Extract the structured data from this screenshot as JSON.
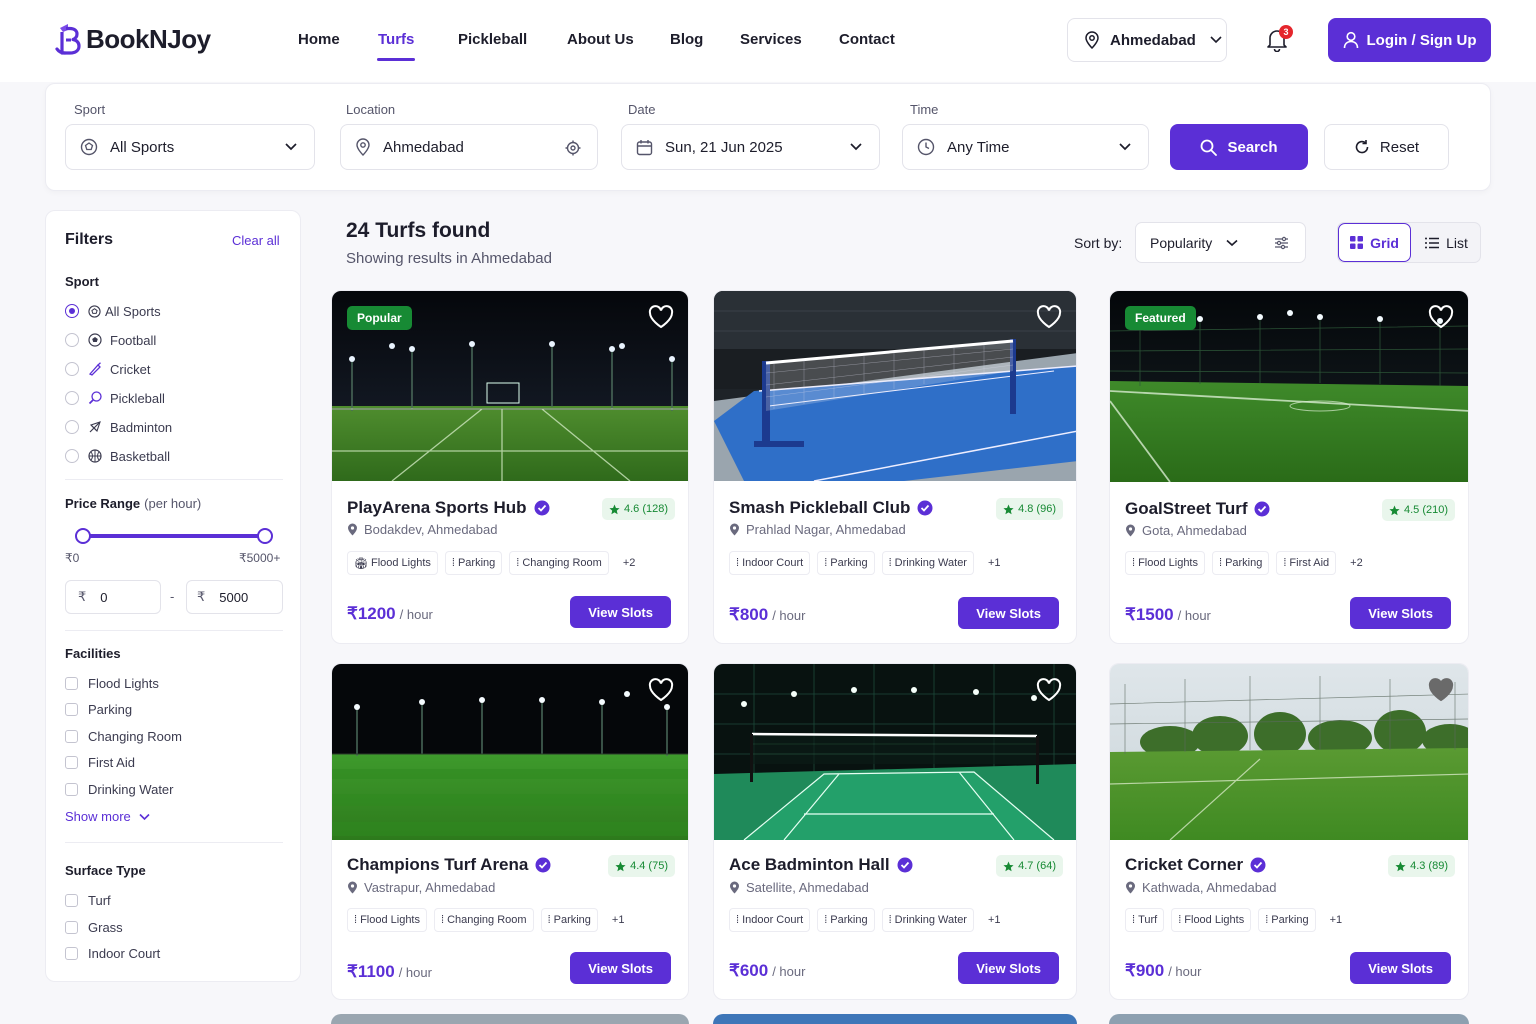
{
  "brand": {
    "name": "BookNJoy",
    "accent": "#5b2fd6"
  },
  "nav": {
    "items": [
      "Home",
      "Turfs",
      "Pickleball",
      "About Us",
      "Blog",
      "Services",
      "Contact"
    ],
    "active": "Turfs"
  },
  "header": {
    "city": "Ahmedabad",
    "notifications": "3",
    "login_label": "Login / Sign Up"
  },
  "search": {
    "sport_label": "Sport",
    "sport_value": "All Sports",
    "location_label": "Location",
    "location_value": "Ahmedabad",
    "date_label": "Date",
    "date_value": "Sun, 21 Jun 2025",
    "time_label": "Time",
    "time_value": "Any Time",
    "search_label": "Search",
    "reset_label": "Reset"
  },
  "filters": {
    "title": "Filters",
    "clear_label": "Clear all",
    "sport_title": "Sport",
    "sports": [
      "All Sports",
      "Football",
      "Cricket",
      "Pickleball",
      "Badminton",
      "Basketball"
    ],
    "sport_selected": "All Sports",
    "price_title": "Price Range",
    "price_unit": "(per hour)",
    "price_min_label": "₹0",
    "price_max_label": "₹5000+",
    "currency": "₹",
    "price_min": "0",
    "price_max": "5000",
    "price_sep": "-",
    "facilities_title": "Facilities",
    "facilities": [
      "Flood Lights",
      "Parking",
      "Changing Room",
      "First Aid",
      "Drinking Water"
    ],
    "show_more": "Show more",
    "surface_title": "Surface Type",
    "surfaces": [
      "Turf",
      "Grass",
      "Indoor Court"
    ]
  },
  "results": {
    "title": "24 Turfs found",
    "subtitle": "Showing results in Ahmedabad",
    "sort_label": "Sort by:",
    "sort_value": "Popularity",
    "view_grid": "Grid",
    "view_list": "List"
  },
  "cards": [
    {
      "tag": "Popular",
      "name": "PlayArena Sports Hub",
      "rating": "4.6 (128)",
      "location": "Bodakdev, Ahmedabad",
      "amenities": [
        "Flood Lights",
        "Parking",
        "Changing Room"
      ],
      "more": "+2",
      "price": "₹1200",
      "unit": "/ hour",
      "cta": "View Slots"
    },
    {
      "tag": "",
      "name": "Smash Pickleball Club",
      "rating": "4.8 (96)",
      "location": "Prahlad Nagar, Ahmedabad",
      "amenities": [
        "Indoor Court",
        "Parking",
        "Drinking Water"
      ],
      "more": "+1",
      "price": "₹800",
      "unit": "/ hour",
      "cta": "View Slots"
    },
    {
      "tag": "Featured",
      "name": "GoalStreet Turf",
      "rating": "4.5 (210)",
      "location": "Gota, Ahmedabad",
      "amenities": [
        "Flood Lights",
        "Parking",
        "First Aid"
      ],
      "more": "+2",
      "price": "₹1500",
      "unit": "/ hour",
      "cta": "View Slots"
    },
    {
      "tag": "",
      "name": "Champions Turf Arena",
      "rating": "4.4 (75)",
      "location": "Vastrapur, Ahmedabad",
      "amenities": [
        "Flood Lights",
        "Changing Room",
        "Parking"
      ],
      "more": "+1",
      "price": "₹1100",
      "unit": "/ hour",
      "cta": "View Slots"
    },
    {
      "tag": "",
      "name": "Ace Badminton Hall",
      "rating": "4.7 (64)",
      "location": "Satellite, Ahmedabad",
      "amenities": [
        "Indoor Court",
        "Parking",
        "Drinking Water"
      ],
      "more": "+1",
      "price": "₹600",
      "unit": "/ hour",
      "cta": "View Slots"
    },
    {
      "tag": "",
      "name": "Cricket Corner",
      "rating": "4.3 (89)",
      "location": "Kathwada, Ahmedabad",
      "amenities": [
        "Turf",
        "Flood Lights",
        "Parking"
      ],
      "more": "+1",
      "price": "₹900",
      "unit": "/ hour",
      "cta": "View Slots"
    }
  ]
}
